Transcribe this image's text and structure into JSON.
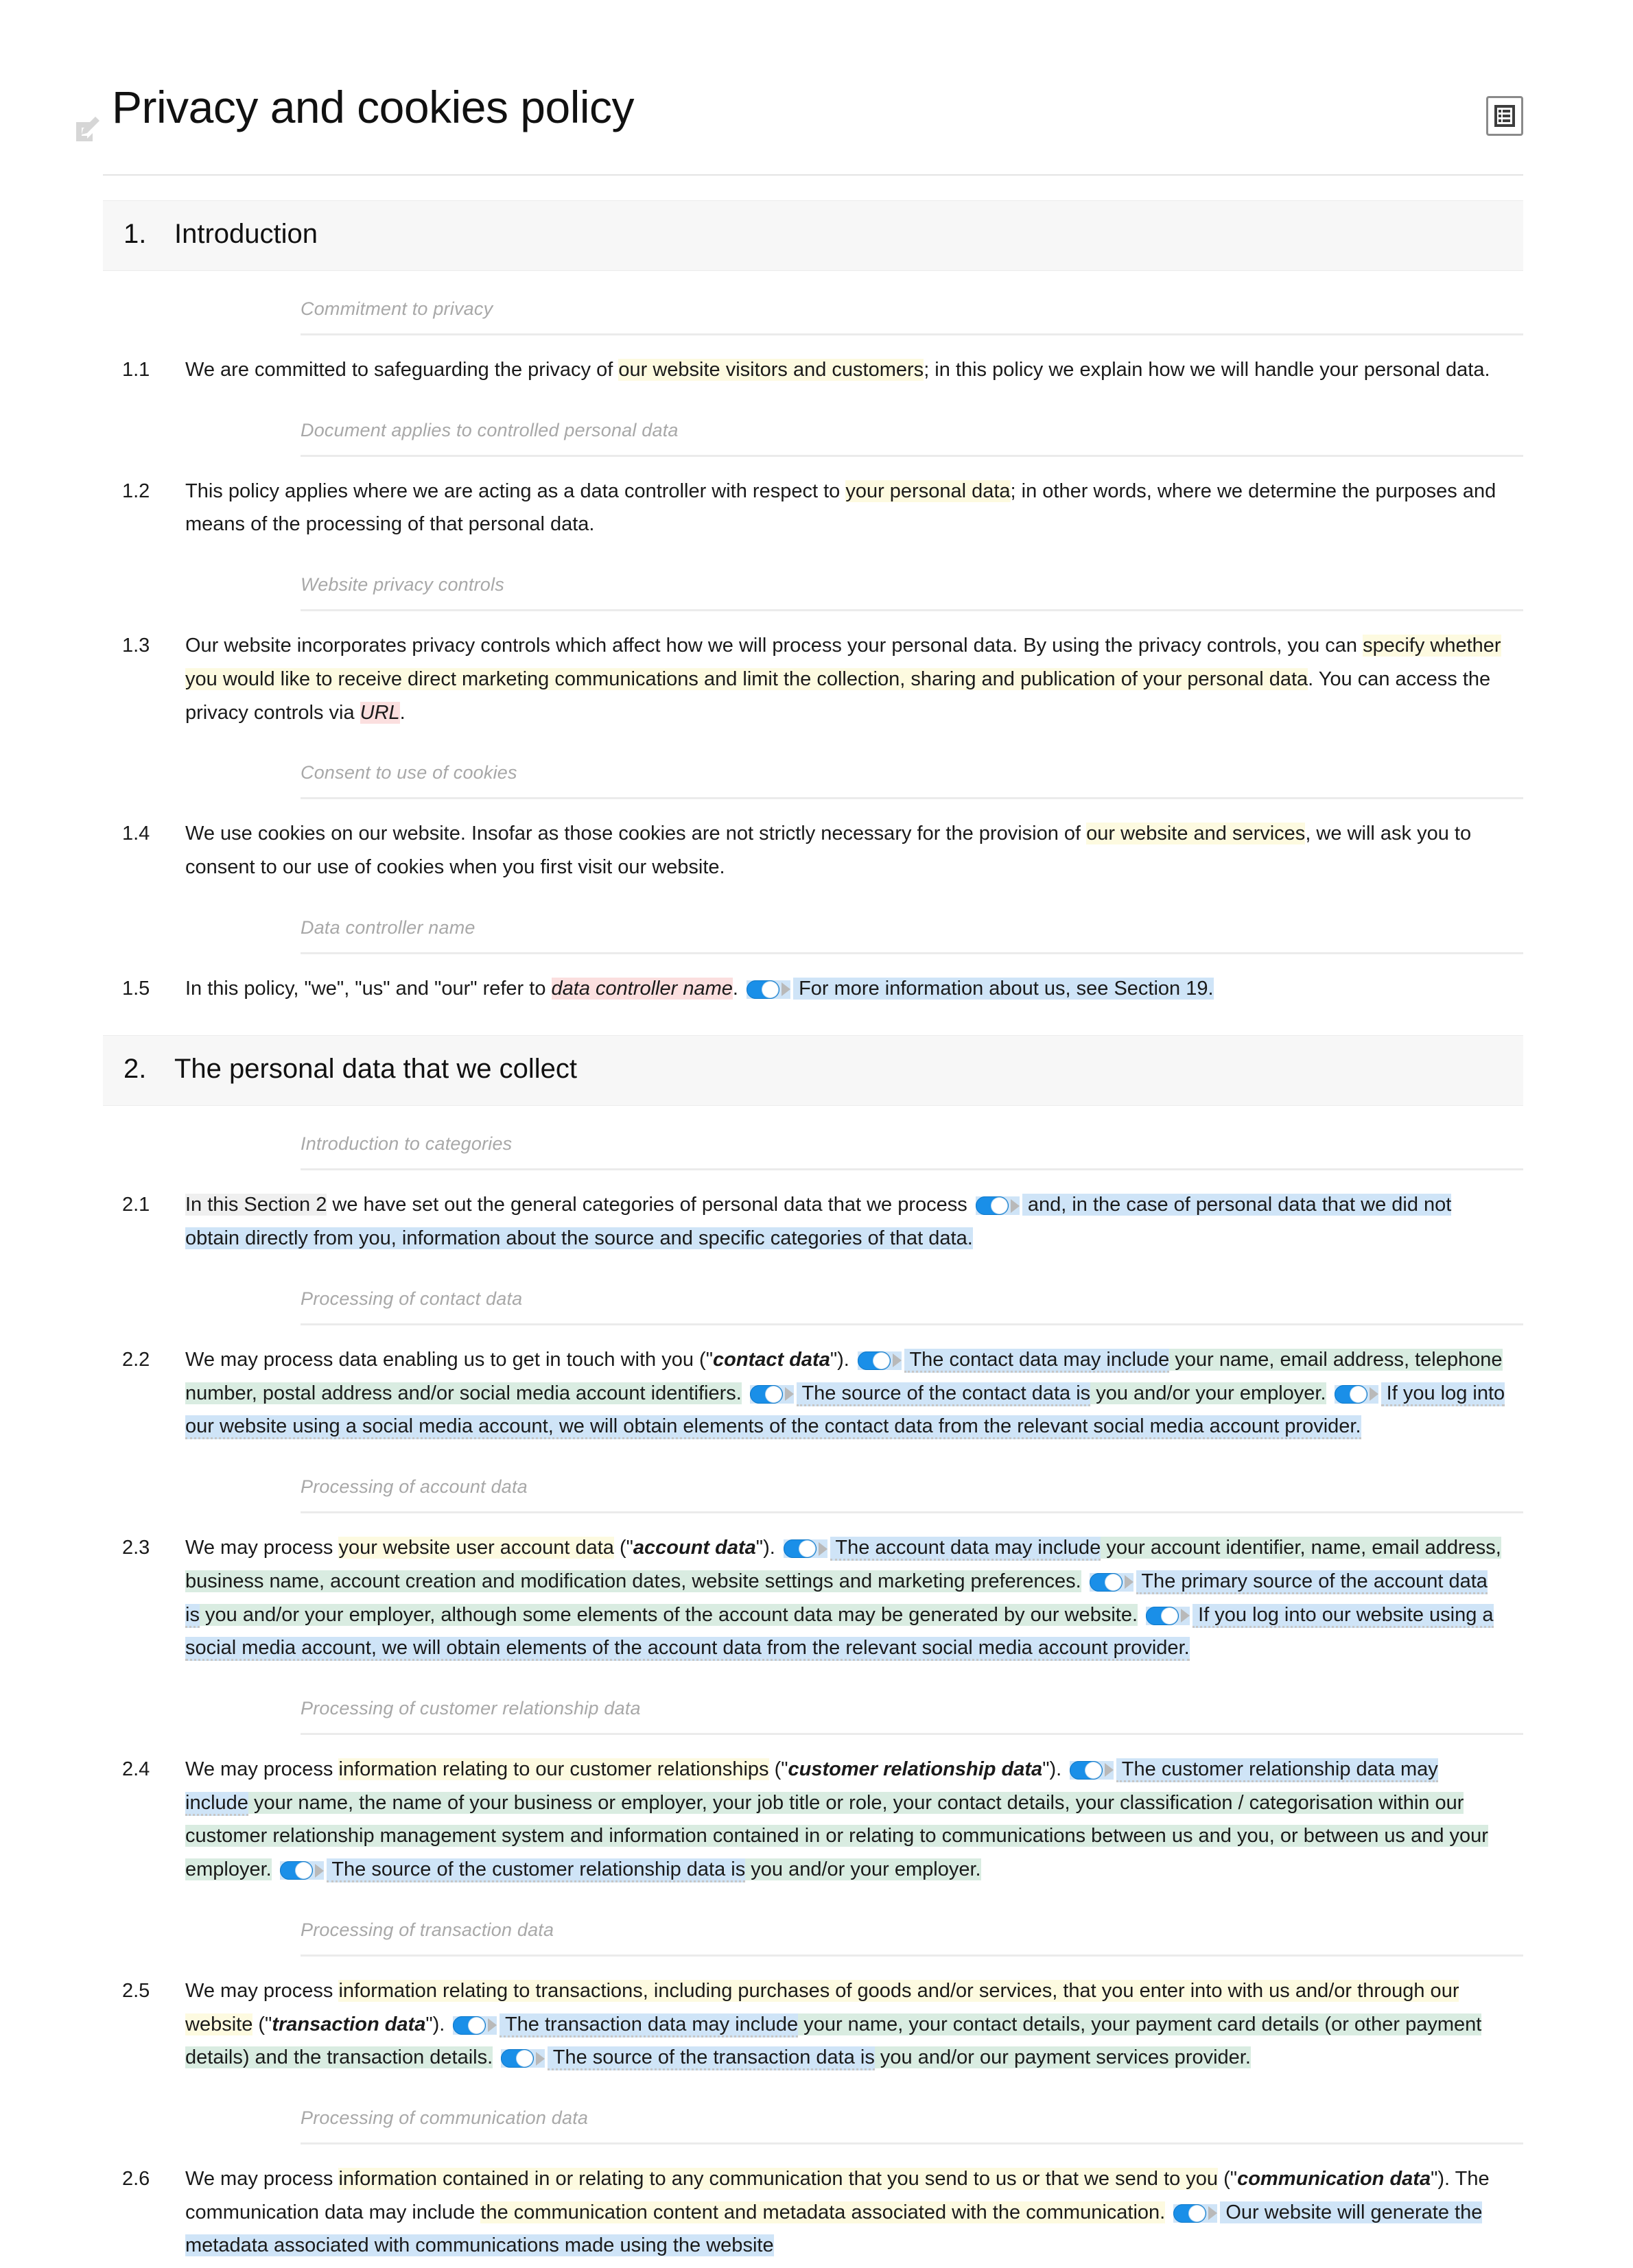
{
  "document": {
    "title": "Privacy and cookies policy",
    "edit_icon": "pencil-edit-icon",
    "toolbar_icon": "document-outline-icon"
  },
  "sections": [
    {
      "number": "1.",
      "title": "Introduction",
      "blocks": [
        {
          "caption": "Commitment to privacy",
          "number": "1.1",
          "runs": [
            {
              "text": "We are committed to safeguarding the privacy of "
            },
            {
              "text": "our website visitors and customers",
              "hl": "yellow"
            },
            {
              "text": "; in this policy we explain how we will handle your personal data."
            }
          ]
        },
        {
          "caption": "Document applies to controlled personal data",
          "number": "1.2",
          "runs": [
            {
              "text": "This policy applies where we are acting as a data controller with respect to "
            },
            {
              "text": "your personal data",
              "hl": "yellow"
            },
            {
              "text": "; in other words, where we determine the purposes and means of the processing of that personal data."
            }
          ]
        },
        {
          "caption": "Website privacy controls",
          "number": "1.3",
          "runs": [
            {
              "text": "Our website incorporates privacy controls which affect how we will process your personal data. By using the privacy controls, you can "
            },
            {
              "text": "specify whether you would like to receive direct marketing communications and limit the collection, sharing and publication of your personal data",
              "hl": "yellow"
            },
            {
              "text": ". You can access the privacy controls via "
            },
            {
              "text": "URL",
              "hl": "pink",
              "style": "italic"
            },
            {
              "text": "."
            }
          ]
        },
        {
          "caption": "Consent to use of cookies",
          "number": "1.4",
          "runs": [
            {
              "text": "We use cookies on our website. Insofar as those cookies are not strictly necessary for the provision of "
            },
            {
              "text": "our website and services",
              "hl": "yellow"
            },
            {
              "text": ", we will ask you to consent to our use of cookies when you first visit our website."
            }
          ]
        },
        {
          "caption": "Data controller name",
          "number": "1.5",
          "runs": [
            {
              "text": "In this policy, \"we\", \"us\" and \"our\" refer to "
            },
            {
              "text": "data controller name",
              "hl": "pink",
              "style": "italic"
            },
            {
              "text": ". "
            },
            {
              "toggle": true,
              "hl": "blue"
            },
            {
              "text": " For more information about us, see Section 19.",
              "hl": "blue"
            }
          ]
        }
      ]
    },
    {
      "number": "2.",
      "title": "The personal data that we collect",
      "blocks": [
        {
          "caption": "Introduction to categories",
          "number": "2.1",
          "runs": [
            {
              "text": "In this Section 2",
              "hl": "gray"
            },
            {
              "text": " we have set out the general categories of personal data that we process "
            },
            {
              "toggle": true,
              "hl": "blue"
            },
            {
              "text": " and, in the case of personal data that we did not obtain directly from you, information about the source and specific categories of that data.",
              "hl": "blue"
            }
          ]
        },
        {
          "caption": "Processing of contact data",
          "number": "2.2",
          "runs": [
            {
              "text": "We may process data enabling us to get in touch with you (\""
            },
            {
              "text": "contact data",
              "style": "bold-italic"
            },
            {
              "text": "\"). "
            },
            {
              "toggle": true,
              "hl": "blue"
            },
            {
              "text": " The contact data may include",
              "hl": "blue",
              "dotted": true
            },
            {
              "text": " your name, email address, telephone number, postal address and/or social media account identifiers.",
              "hl": "green"
            },
            {
              "text": " "
            },
            {
              "toggle": true,
              "hl": "blue"
            },
            {
              "text": " The source of the contact data is",
              "hl": "blue",
              "dotted": true
            },
            {
              "text": " you and/or your employer.",
              "hl": "green"
            },
            {
              "text": " "
            },
            {
              "toggle": true,
              "hl": "blue"
            },
            {
              "text": " If you log into our website using a social media account, we will obtain elements of the contact data from the relevant social media account provider.",
              "hl": "blue",
              "dotted": true
            }
          ]
        },
        {
          "caption": "Processing of account data",
          "number": "2.3",
          "runs": [
            {
              "text": "We may process "
            },
            {
              "text": "your website user account data",
              "hl": "yellow"
            },
            {
              "text": " (\""
            },
            {
              "text": "account data",
              "style": "bold-italic"
            },
            {
              "text": "\"). "
            },
            {
              "toggle": true,
              "hl": "blue"
            },
            {
              "text": " The account data may include",
              "hl": "blue",
              "dotted": true
            },
            {
              "text": " your account identifier, name, email address, business name, account creation and modification dates, website settings and marketing preferences.",
              "hl": "green"
            },
            {
              "text": " "
            },
            {
              "toggle": true,
              "hl": "blue"
            },
            {
              "text": " The primary source of the account data is",
              "hl": "blue",
              "dotted": true
            },
            {
              "text": " you and/or your employer, although some elements of the account data may be generated by our website.",
              "hl": "green"
            },
            {
              "text": " "
            },
            {
              "toggle": true,
              "hl": "blue"
            },
            {
              "text": " If you log into our website using a social media account, we will obtain elements of the account data from the relevant social media account provider.",
              "hl": "blue",
              "dotted": true
            }
          ]
        },
        {
          "caption": "Processing of customer relationship data",
          "number": "2.4",
          "runs": [
            {
              "text": "We may process "
            },
            {
              "text": "information relating to our customer relationships",
              "hl": "yellow"
            },
            {
              "text": " (\""
            },
            {
              "text": "customer relationship data",
              "style": "bold-italic"
            },
            {
              "text": "\"). "
            },
            {
              "toggle": true,
              "hl": "blue"
            },
            {
              "text": " The customer relationship data may include",
              "hl": "blue",
              "dotted": true
            },
            {
              "text": " your name, the name of your business or employer, your job title or role, your contact details, your classification / categorisation within our customer relationship management system and information contained in or relating to communications between us and you, or between us and your employer.",
              "hl": "green"
            },
            {
              "text": " "
            },
            {
              "toggle": true,
              "hl": "blue"
            },
            {
              "text": " The source of the customer relationship data is",
              "hl": "blue",
              "dotted": true
            },
            {
              "text": " you and/or your employer.",
              "hl": "green"
            }
          ]
        },
        {
          "caption": "Processing of transaction data",
          "number": "2.5",
          "runs": [
            {
              "text": "We may process "
            },
            {
              "text": "information relating to transactions, including purchases of goods and/or services, that you enter into with us and/or through our website",
              "hl": "yellow"
            },
            {
              "text": " (\""
            },
            {
              "text": "transaction data",
              "style": "bold-italic"
            },
            {
              "text": "\"). "
            },
            {
              "toggle": true,
              "hl": "blue"
            },
            {
              "text": " The transaction data may include",
              "hl": "blue",
              "dotted": true
            },
            {
              "text": " your name, your contact details, your payment card details (or other payment details) and the transaction details.",
              "hl": "green"
            },
            {
              "text": " "
            },
            {
              "toggle": true,
              "hl": "blue"
            },
            {
              "text": " The source of the transaction data is",
              "hl": "blue",
              "dotted": true
            },
            {
              "text": " you and/or our payment services provider.",
              "hl": "green"
            }
          ]
        },
        {
          "caption": "Processing of communication data",
          "number": "2.6",
          "runs": [
            {
              "text": "We may process "
            },
            {
              "text": "information contained in or relating to any communication that you send to us or that we send to you",
              "hl": "yellow"
            },
            {
              "text": " (\""
            },
            {
              "text": "communication data",
              "style": "bold-italic"
            },
            {
              "text": "\"). The communication data may include "
            },
            {
              "text": "the communication content and metadata associated with the communication.",
              "hl": "yellow"
            },
            {
              "text": " "
            },
            {
              "toggle": true,
              "hl": "blue"
            },
            {
              "text": " Our website will generate the metadata associated with communications made using the website",
              "hl": "blue"
            }
          ]
        }
      ]
    }
  ],
  "colors": {
    "highlight_yellow": "#fdfae0",
    "highlight_pink": "#fbdfdf",
    "highlight_blue": "#cfe4f7",
    "highlight_green": "#d9ece1",
    "highlight_gray": "#efefef",
    "toggle_on": "#1a8fe8",
    "section_band": "#f7f7f7",
    "caption_text": "#a8a8a8"
  }
}
